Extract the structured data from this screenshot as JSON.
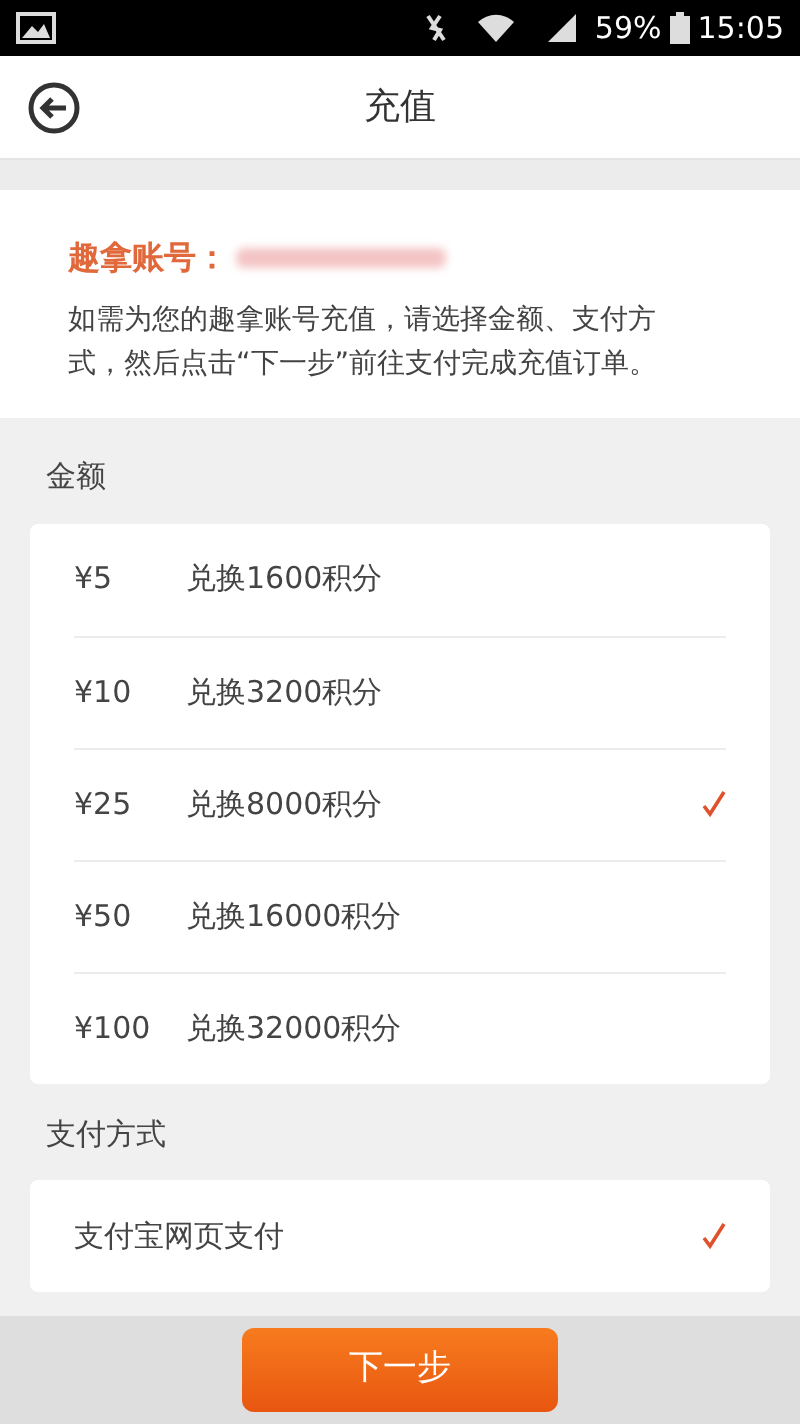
{
  "status_bar": {
    "battery": "59%",
    "time": "15:05"
  },
  "header": {
    "title": "充值"
  },
  "account": {
    "label": "趣拿账号：",
    "hint": "如需为您的趣拿账号充值，请选择金额、支付方式，然后点击“下一步”前往支付完成充值订单。"
  },
  "amount_section": {
    "title": "金额",
    "options": [
      {
        "price": "¥5",
        "points": "兑换1600积分",
        "selected": false
      },
      {
        "price": "¥10",
        "points": "兑换3200积分",
        "selected": false
      },
      {
        "price": "¥25",
        "points": "兑换8000积分",
        "selected": true
      },
      {
        "price": "¥50",
        "points": "兑换16000积分",
        "selected": false
      },
      {
        "price": "¥100",
        "points": "兑换32000积分",
        "selected": false
      }
    ]
  },
  "payment_section": {
    "title": "支付方式",
    "options": [
      {
        "label": "支付宝网页支付",
        "selected": true
      }
    ]
  },
  "next_button": {
    "label": "下一步"
  }
}
